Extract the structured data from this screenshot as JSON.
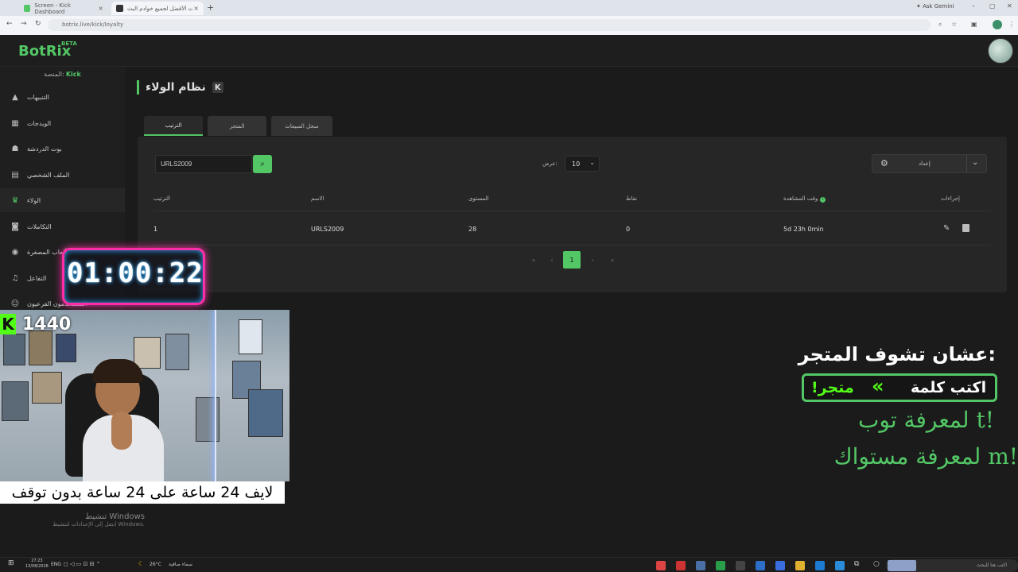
{
  "browser": {
    "tabs": [
      {
        "title": "Screen - Kick Dashboard",
        "fav_color": "#53c766"
      },
      {
        "title": "البوت الأفضل لجميع خوادم البث",
        "fav_color": "#333333"
      }
    ],
    "new_tab": "+",
    "ask_gemini": "Ask Gemini",
    "url": "botrix.live/kick/loyalty",
    "profile_letter": "B"
  },
  "app": {
    "logo": "BotRix",
    "logo_badge": "BETA",
    "platform_label": "المنصة:",
    "platform_value": "Kick"
  },
  "sidebar": {
    "items": [
      {
        "label": "التنبيهات",
        "icon": "warning-icon",
        "glyph": "▲"
      },
      {
        "label": "الويدجات",
        "icon": "widgets-icon",
        "glyph": "▦"
      },
      {
        "label": "بوت الدردشة",
        "icon": "robot-icon",
        "glyph": "☗"
      },
      {
        "label": "الملف الشخصي",
        "icon": "id-card-icon",
        "glyph": "▤"
      },
      {
        "label": "الولاء",
        "icon": "trophy-icon",
        "glyph": "♛"
      },
      {
        "label": "التكاملات",
        "icon": "integrations-icon",
        "glyph": "◙"
      },
      {
        "label": "ألعاب المصغرة",
        "icon": "gamepad-icon",
        "glyph": "◉"
      },
      {
        "label": "التفاعل",
        "icon": "music-icon",
        "glyph": "♫"
      },
      {
        "label": "المستخدمون الفرعيون",
        "icon": "users-icon",
        "glyph": "☺"
      }
    ],
    "active_index": 4
  },
  "page": {
    "title": "نظام الولاء",
    "kick_badge": "K",
    "tabs": [
      "الترتيب",
      "المتجر",
      "سجل المبيعات"
    ],
    "active_tab": 0
  },
  "controls": {
    "search_value": "URLS2009",
    "show_label": "عرض:",
    "show_value": "10",
    "settings_label": "إعداد"
  },
  "table": {
    "headers": {
      "rank": "الترتيب",
      "name": "الاسم",
      "level": "المستوى",
      "points": "نقاط",
      "watchtime": "وقت المشاهدة",
      "actions": "إجراءات"
    },
    "rows": [
      {
        "rank": "1",
        "name": "URLS2009",
        "level": "28",
        "points": "0",
        "watchtime": "5d 23h 0min"
      }
    ]
  },
  "pagination": {
    "first": "«",
    "prev": "‹",
    "current": "1",
    "next": "›",
    "last": "»"
  },
  "overlay": {
    "timer": "01:00:22",
    "kick_letter": "K",
    "viewer_count": "1440",
    "caption": "لايف  24 ساعة على 24 ساعة بدون توقف",
    "promo_title": "عشان تشوف المتجر:",
    "promo_write": "اكتب كلمة",
    "promo_chevrons": "«",
    "promo_command": "!متجر",
    "promo_line1": "لمعرفة توب    t!",
    "promo_line2": "لمعرفة مستواك    m!"
  },
  "windows": {
    "activate_title": "تنشيط Windows",
    "activate_sub": "انتقل إلى الإعدادات لتنشيط Windows."
  },
  "taskbar": {
    "time": "27:23",
    "date": "13/08/2026",
    "lang": "ENG",
    "temperature": "26°C",
    "weather": "سماء صافية",
    "search_placeholder": "اكتب هنا للبحث"
  },
  "colors": {
    "accent": "#53c766",
    "kick_green": "#53fc18",
    "timer_border": "#ff2ea6",
    "background": "#1b1b1b"
  }
}
